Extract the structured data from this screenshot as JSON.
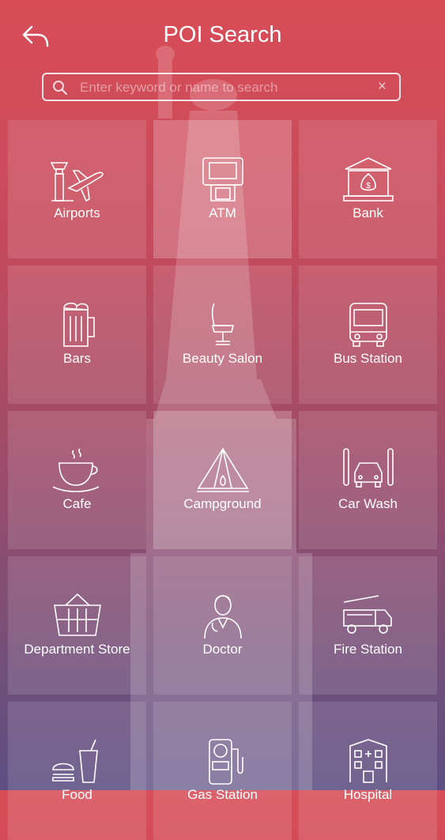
{
  "header": {
    "title": "POI Search",
    "back_icon": "back-arrow-icon"
  },
  "search": {
    "placeholder": "Enter keyword or name to search",
    "value": "",
    "clear_label": "×"
  },
  "categories": [
    {
      "label": "Airports",
      "icon": "airport-icon"
    },
    {
      "label": "ATM",
      "icon": "atm-icon"
    },
    {
      "label": "Bank",
      "icon": "bank-icon"
    },
    {
      "label": "Bars",
      "icon": "beer-mug-icon"
    },
    {
      "label": "Beauty Salon",
      "icon": "salon-chair-icon"
    },
    {
      "label": "Bus Station",
      "icon": "bus-icon"
    },
    {
      "label": "Cafe",
      "icon": "coffee-cup-icon"
    },
    {
      "label": "Campground",
      "icon": "tent-icon"
    },
    {
      "label": "Car Wash",
      "icon": "car-wash-icon"
    },
    {
      "label": "Department Store",
      "icon": "basket-icon"
    },
    {
      "label": "Doctor",
      "icon": "doctor-icon"
    },
    {
      "label": "Fire Station",
      "icon": "fire-truck-icon"
    },
    {
      "label": "Food",
      "icon": "burger-drink-icon"
    },
    {
      "label": "Gas Station",
      "icon": "fuel-pump-icon"
    },
    {
      "label": "Hospital",
      "icon": "hospital-building-icon"
    }
  ]
}
